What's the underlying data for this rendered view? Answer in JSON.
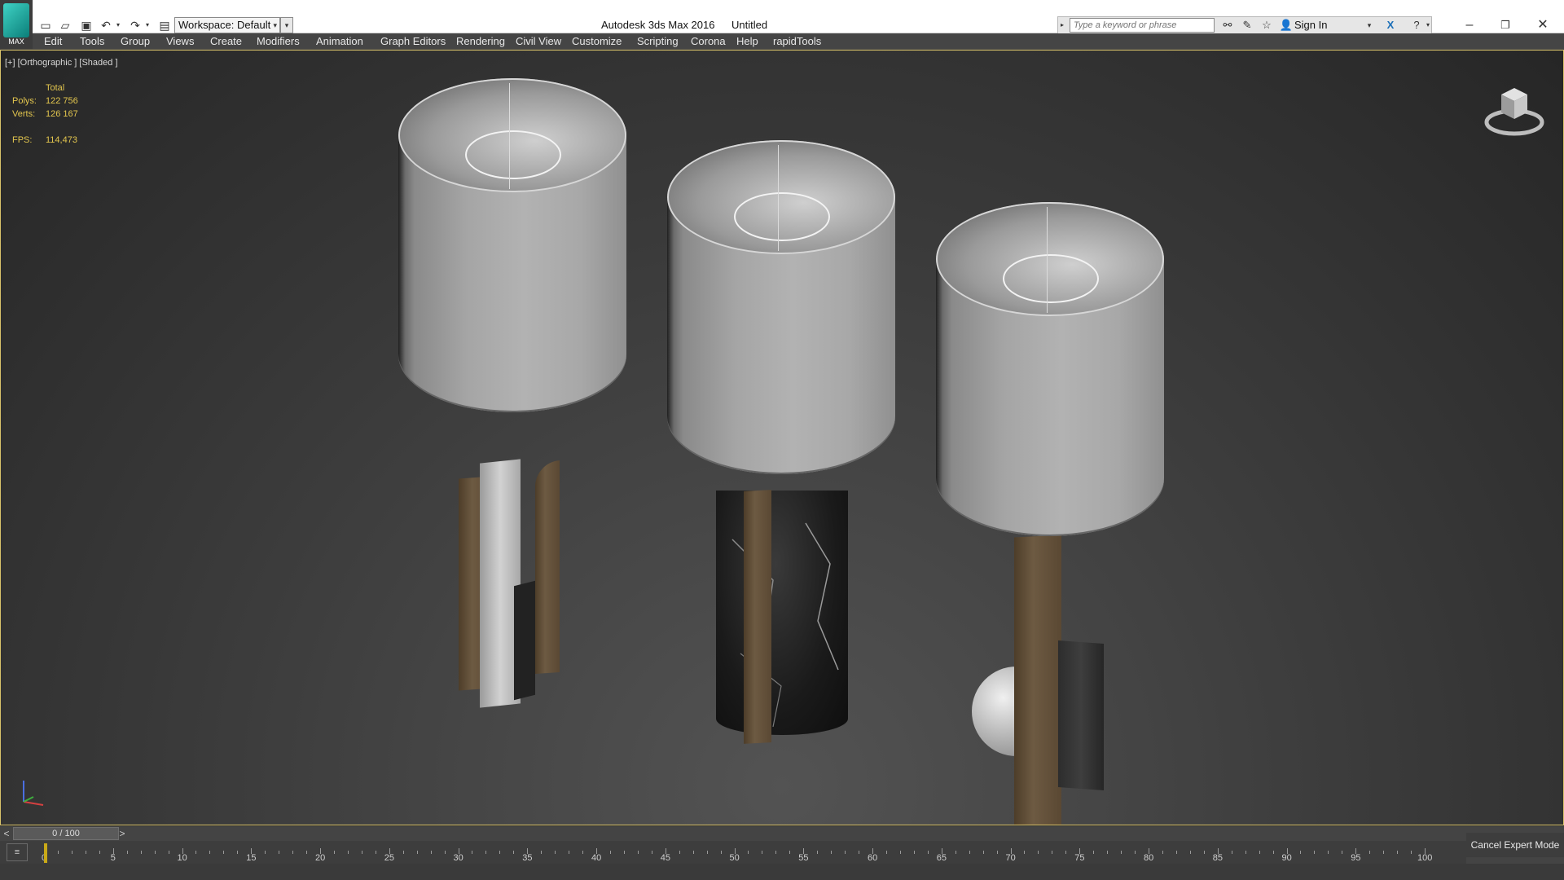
{
  "titlebar": {
    "app_logo_text": "MAX",
    "workspace_label": "Workspace: Default",
    "app_title": "Autodesk 3ds Max 2016",
    "doc_title": "Untitled",
    "search_placeholder": "Type a keyword or phrase",
    "signin_label": "Sign In"
  },
  "menubar": {
    "items": [
      "Edit",
      "Tools",
      "Group",
      "Views",
      "Create",
      "Modifiers",
      "Animation",
      "Graph Editors",
      "Rendering",
      "Civil View",
      "Customize",
      "Scripting",
      "Corona",
      "Help",
      "rapidTools"
    ]
  },
  "viewport": {
    "label": "[+] [Orthographic ] [Shaded ]",
    "stats_header": "Total",
    "polys_label": "Polys:",
    "polys_value": "122 756",
    "verts_label": "Verts:",
    "verts_value": "126 167",
    "fps_label": "FPS:",
    "fps_value": "114,473"
  },
  "timeline": {
    "slider_label": "0 / 100",
    "prev": "<",
    "next": ">",
    "ticks": [
      "0",
      "5",
      "10",
      "15",
      "20",
      "25",
      "30",
      "35",
      "40",
      "45",
      "50",
      "55",
      "60",
      "65",
      "70",
      "75",
      "80",
      "85",
      "90",
      "95",
      "100"
    ],
    "current_frame": 0,
    "total_frames": 100
  },
  "status": {
    "expert_mode": "Cancel Expert Mode"
  },
  "colors": {
    "stats_text": "#e3c64e",
    "viewport_border": "#d8c26a",
    "playhead": "#c9a918"
  }
}
